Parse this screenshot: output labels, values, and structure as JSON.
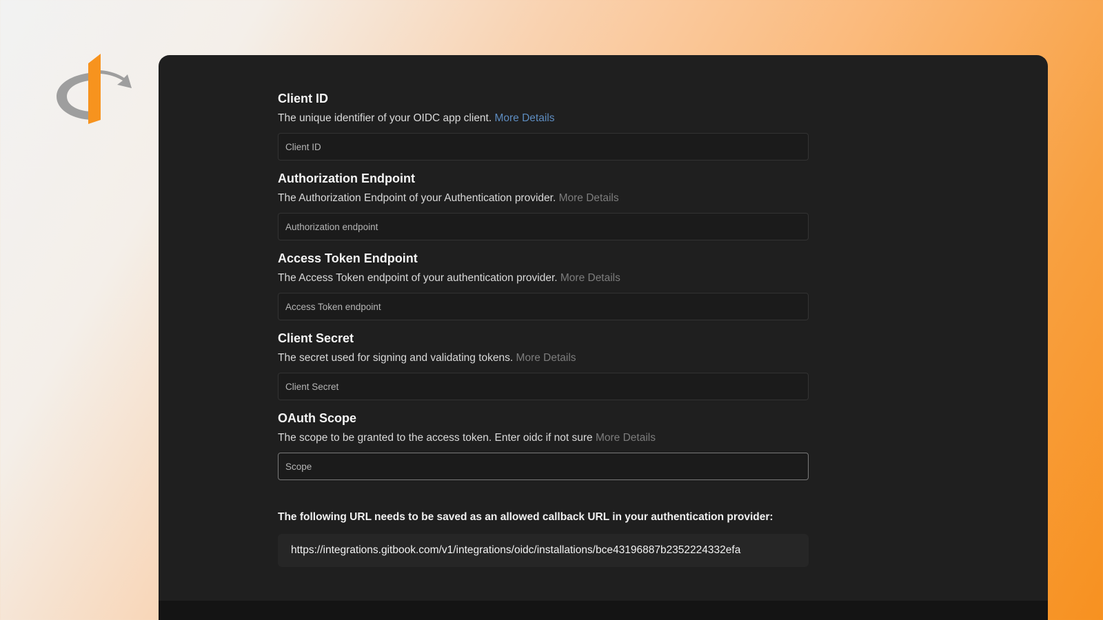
{
  "brand": {
    "logo_icon": "openid-logo-icon",
    "orange": "#f7931e",
    "gray": "#9a9a9a"
  },
  "fields": [
    {
      "title": "Client ID",
      "description": "The unique identifier of your OIDC app client.",
      "link": "More Details",
      "placeholder": "Client ID"
    },
    {
      "title": "Authorization Endpoint",
      "description": "The Authorization Endpoint of your Authentication provider.",
      "link": "More Details",
      "placeholder": "Authorization endpoint"
    },
    {
      "title": "Access Token Endpoint",
      "description": "The Access Token endpoint of your authentication provider.",
      "link": "More Details",
      "placeholder": "Access Token endpoint"
    },
    {
      "title": "Client Secret",
      "description": "The secret used for signing and validating tokens.",
      "link": "More Details",
      "placeholder": "Client Secret"
    },
    {
      "title": "OAuth Scope",
      "description": "The scope to be granted to the access token. Enter oidc if not sure",
      "link": "More Details",
      "placeholder": "Scope"
    }
  ],
  "callback": {
    "label": "The following URL needs to be saved as an allowed callback URL in your authentication provider:",
    "url": "https://integrations.gitbook.com/v1/integrations/oidc/installations/bce43196887b2352224332efa"
  }
}
